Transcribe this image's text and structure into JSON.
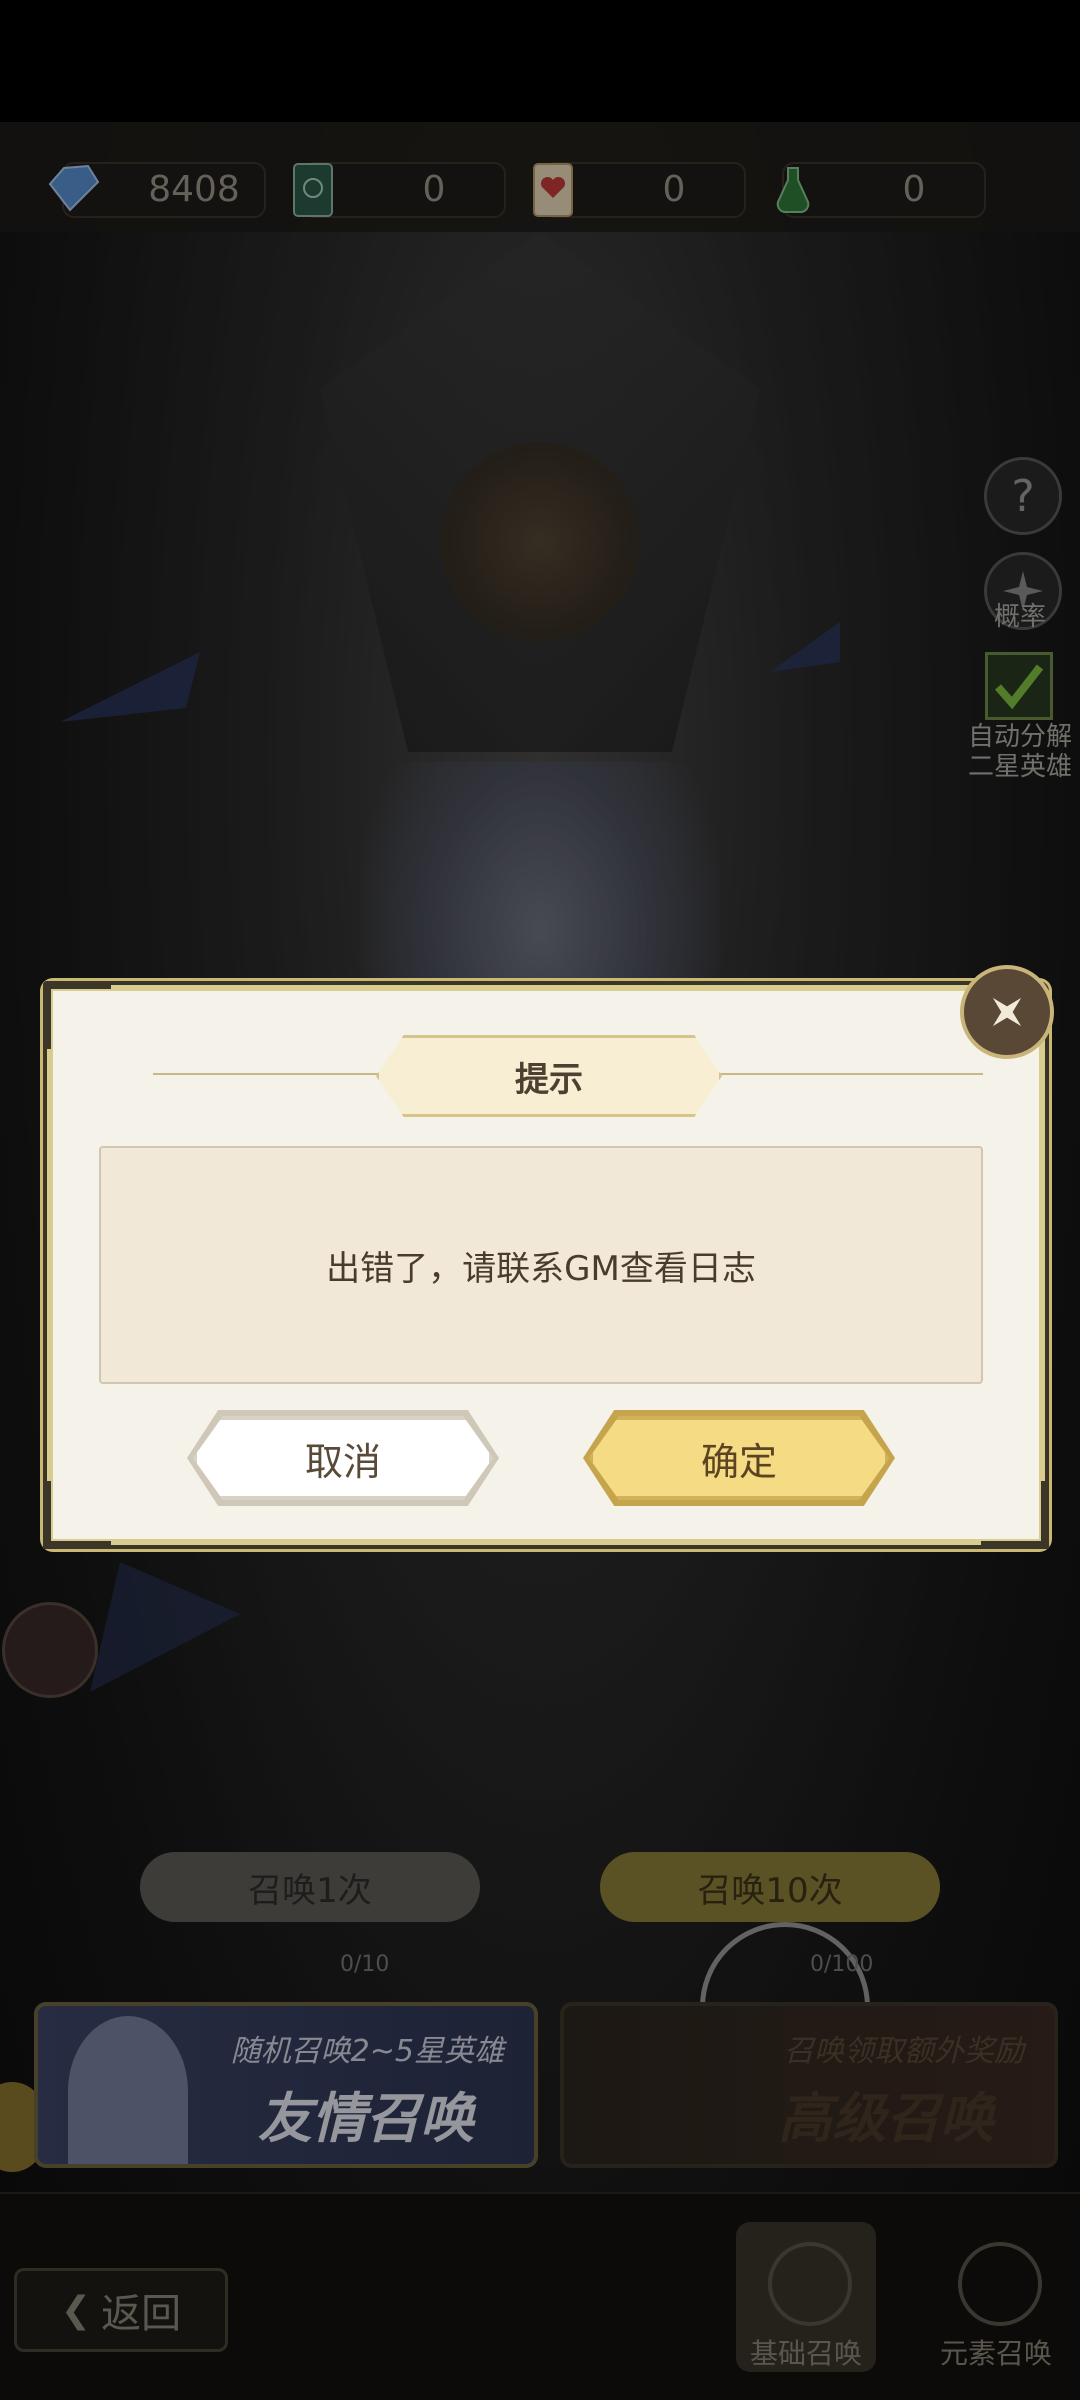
{
  "resources": [
    {
      "icon": "diamond-icon",
      "value": "8408"
    },
    {
      "icon": "green-card-icon",
      "value": "0"
    },
    {
      "icon": "heart-card-icon",
      "value": "0"
    },
    {
      "icon": "green-potion-icon",
      "value": "0"
    }
  ],
  "side": {
    "help_glyph": "?",
    "probability_label": "概率",
    "auto_decompose_label_1": "自动分解",
    "auto_decompose_label_2": "二星英雄"
  },
  "summon": {
    "once_label": "召唤1次",
    "ten_label": "召唤10次",
    "once_cost": "0/10",
    "ten_cost": "0/100"
  },
  "banners": {
    "friend_line1": "随机召唤2~5星英雄",
    "friend_line2": "友情召唤",
    "premium_line1": "召唤领取额外奖励",
    "premium_line2": "高级召唤"
  },
  "bottom": {
    "back_label": "返回",
    "tab_basic": "基础召唤",
    "tab_element": "元素召唤"
  },
  "dialog": {
    "title": "提示",
    "message": "出错了，请联系GM查看日志",
    "cancel_label": "取消",
    "confirm_label": "确定"
  }
}
